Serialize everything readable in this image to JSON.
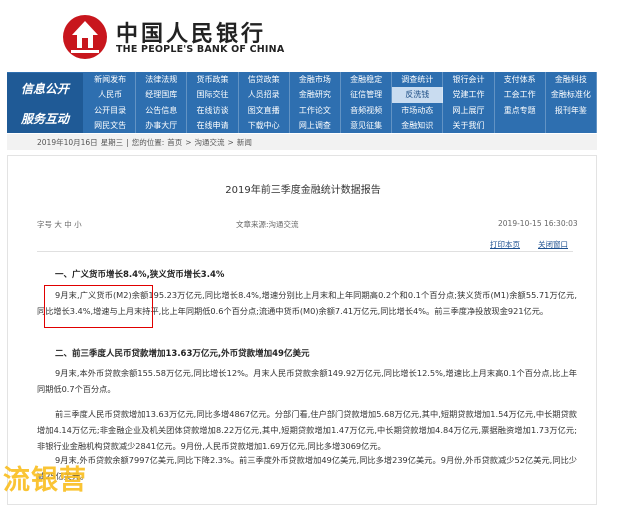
{
  "header": {
    "logo_cn": "中国人民银行",
    "logo_en": "THE PEOPLE'S BANK OF CHINA"
  },
  "nav": {
    "cat1": "信息公开",
    "cat2": "服务互动",
    "items": [
      "新闻发布",
      "法律法规",
      "货币政策",
      "信贷政策",
      "金融市场",
      "金融稳定",
      "调查统计",
      "银行会计",
      "支付体系",
      "金融科技",
      "人民币",
      "经理国库",
      "国际交往",
      "人员招录",
      "金融研究",
      "征信管理",
      "反洗钱",
      "党建工作",
      "工会工作",
      "金融标准化",
      "公开目录",
      "公告信息",
      "在线访谈",
      "图文直播",
      "工作论文",
      "音频视频",
      "市场动态",
      "网上展厅",
      "重点专题",
      "报刊年鉴",
      "网民文告",
      "办事大厅",
      "在线申请",
      "下载中心",
      "网上调查",
      "意见征集",
      "金融知识",
      "关于我们",
      "",
      ""
    ]
  },
  "breadcrumb": {
    "date": "2019年10月16日",
    "weekday": "星期三",
    "location_label": "您的位置:",
    "home": "首页",
    "section": "沟通交流",
    "page": "新闻"
  },
  "article": {
    "title": "2019年前三季度金融统计数据报告",
    "font_size": "字号 大 中 小",
    "source": "文章来源:沟通交流",
    "datetime": "2019-10-15 16:30:03",
    "print": "打印本页",
    "close": "关闭窗口",
    "h1": "一、广义货币增长8.4%,狭义货币增长3.4%",
    "p1": "9月末,广义货币(M2)余额195.23万亿元,同比增长8.4%,增速分别比上月末和上年同期高0.2个和0.1个百分点;狭义货币(M1)余额55.71万亿元,同比增长3.4%,增速与上月末持平,比上年同期低0.6个百分点;流通中货币(M0)余额7.41万亿元,同比增长4%。前三季度净投放现金921亿元。",
    "h2": "二、前三季度人民币贷款增加13.63万亿元,外币贷款增加49亿美元",
    "p2": "9月末,本外币贷款余额155.58万亿元,同比增长12%。月末人民币贷款余额149.92万亿元,同比增长12.5%,增速比上月末高0.1个百分点,比上年同期低0.7个百分点。",
    "p3": "前三季度人民币贷款增加13.63万亿元,同比多增4867亿元。分部门看,住户部门贷款增加5.68万亿元,其中,短期贷款增加1.54万亿元,中长期贷款增加4.14万亿元;非金融企业及机关团体贷款增加8.22万亿元,其中,短期贷款增加1.47万亿元,中长期贷款增加4.84万亿元,票据融资增加1.73万亿元;非银行业金融机构贷款减少2841亿元。9月份,人民币贷款增加1.69万亿元,同比多增3069亿元。",
    "p4": "9月末,外币贷款余额7997亿美元,同比下降2.3%。前三季度外币贷款增加49亿美元,同比多增239亿美元。9月份,外币贷款减少52亿美元,同比少减25亿美元。"
  },
  "watermark": "流银营"
}
